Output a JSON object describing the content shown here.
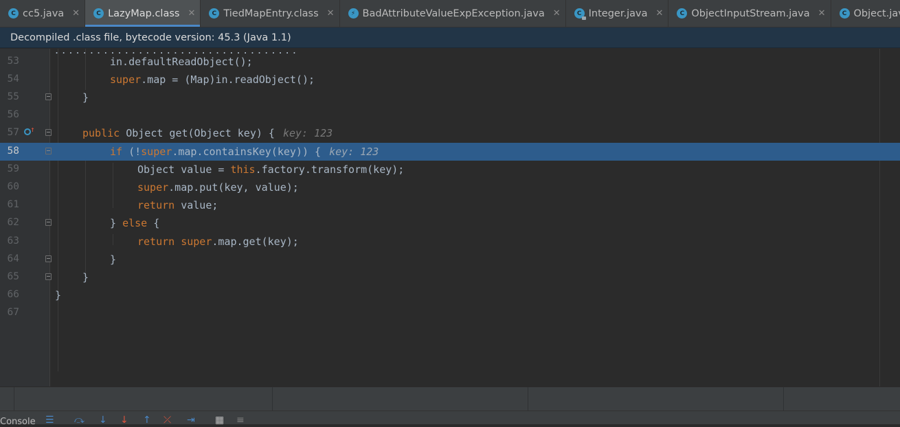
{
  "tabs": [
    {
      "label": "cc5.java",
      "icon": "java-class-icon",
      "active": false
    },
    {
      "label": "LazyMap.class",
      "icon": "java-class-icon",
      "active": true
    },
    {
      "label": "TiedMapEntry.class",
      "icon": "java-class-icon",
      "active": false
    },
    {
      "label": "BadAttributeValueExpException.java",
      "icon": "java-exception-icon",
      "active": false
    },
    {
      "label": "Integer.java",
      "icon": "java-class-locked-icon",
      "active": false
    },
    {
      "label": "ObjectInputStream.java",
      "icon": "java-class-icon",
      "active": false
    },
    {
      "label": "Object.java",
      "icon": "java-class-icon",
      "active": false
    }
  ],
  "banner": {
    "text": "Decompiled .class file, bytecode version: 45.3 (Java 1.1)"
  },
  "editor": {
    "current_line": "58",
    "lines": [
      {
        "no": "53",
        "text": "in.defaultReadObject();"
      },
      {
        "no": "54",
        "kw": "super",
        "text": ".map = (Map)in.readObject();"
      },
      {
        "no": "55",
        "text": "}"
      },
      {
        "no": "56",
        "text": ""
      },
      {
        "no": "57",
        "kw": "public",
        "text": " Object get(Object key) {",
        "hint": "key: 123"
      },
      {
        "no": "58",
        "kw": "if",
        "text": " (!",
        "kw2": "super",
        "text2": ".map.containsKey(key)) {",
        "hint": "key: 123"
      },
      {
        "no": "59",
        "text": "Object value = ",
        "kw": "this",
        "text2": ".factory.transform(key);"
      },
      {
        "no": "60",
        "kw": "super",
        "text": ".map.put(key, value);"
      },
      {
        "no": "61",
        "kw": "return",
        "text": " value;"
      },
      {
        "no": "62",
        "text": "} ",
        "kw": "else",
        "text2": " {"
      },
      {
        "no": "63",
        "kw": "return",
        "text": " ",
        "kw2": "super",
        "text2": ".map.get(key);"
      },
      {
        "no": "64",
        "text": "}"
      },
      {
        "no": "65",
        "text": "}"
      },
      {
        "no": "66",
        "text": "}"
      },
      {
        "no": "67",
        "text": ""
      }
    ]
  },
  "bottom": {
    "console_label": "Console"
  },
  "colors": {
    "keyword": "#cc7832",
    "text": "#a9b7c6",
    "highlight": "#2d5c8c",
    "banner": "#223547"
  }
}
